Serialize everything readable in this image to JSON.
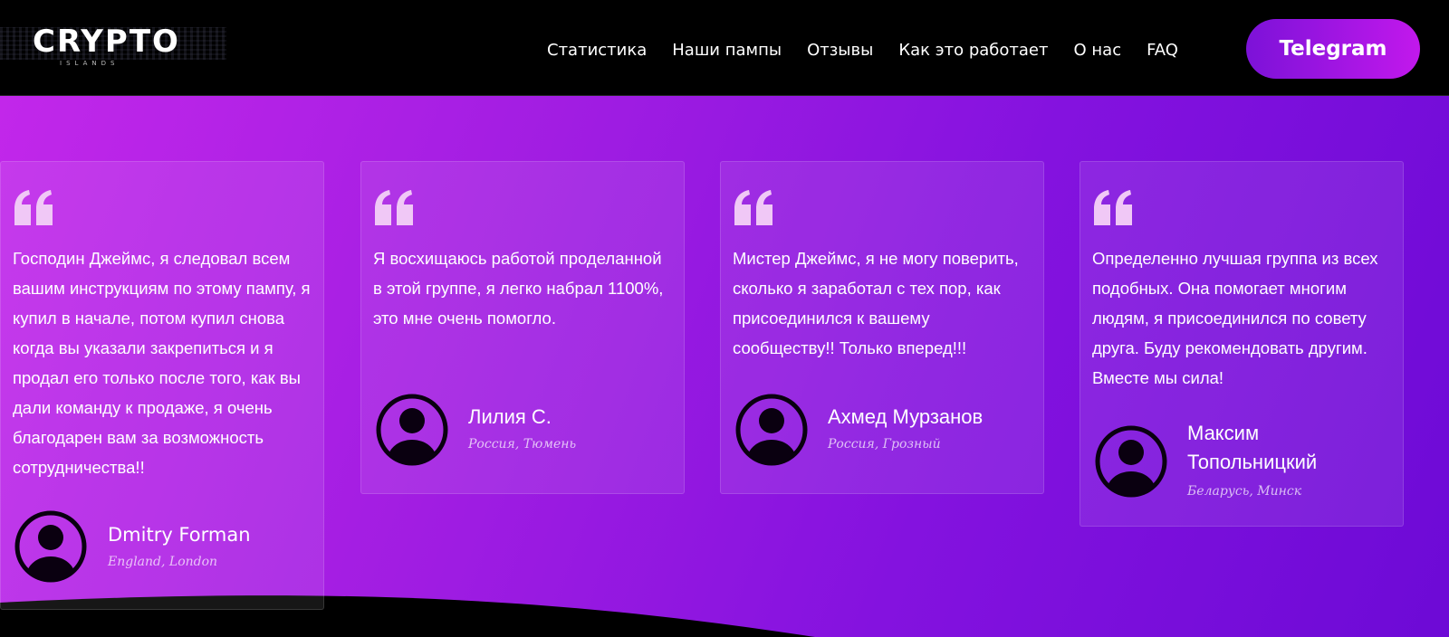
{
  "header": {
    "logo_text": "CRYPTO",
    "logo_sub": "ISLANDS",
    "nav": [
      "Статистика",
      "Наши пампы",
      "Отзывы",
      "Как это работает",
      "О нас",
      "FAQ"
    ],
    "telegram_label": "Telegram"
  },
  "testimonials": [
    {
      "text": "Господин Джеймс, я следовал всем вашим инструкциям по этому пампу, я купил в начале, потом купил снова когда вы указали закрепиться и я продал его только после того, как вы дали команду к продаже, я очень благодарен вам за возможность сотрудничества!!",
      "name": "Dmitry Forman",
      "location": "England, London"
    },
    {
      "text": "Я восхищаюсь работой проделанной в этой группе, я легко набрал 1100%, это мне очень помогло.",
      "name": "Лилия С.",
      "location": "Россия, Тюмень"
    },
    {
      "text": "Мистер Джеймс, я не могу поверить, сколько я заработал с тех пор, как присоединился к вашему сообществу!! Только вперед!!!",
      "name": "Ахмед Мурзанов",
      "location": "Россия, Грозный"
    },
    {
      "text": "Определенно лучшая группа из всех подобных. Она помогает многим людям, я присоединился по совету друга. Буду рекомендовать другим. Вместе мы сила!",
      "name": "Максим Топольницкий",
      "location": "Беларусь, Минск"
    }
  ],
  "icons": {
    "quote": "quote-icon",
    "avatar": "user-avatar-icon"
  },
  "colors": {
    "accent_start": "#7c12d8",
    "accent_end": "#c218ec",
    "quote_icon": "#f0c8f6"
  }
}
